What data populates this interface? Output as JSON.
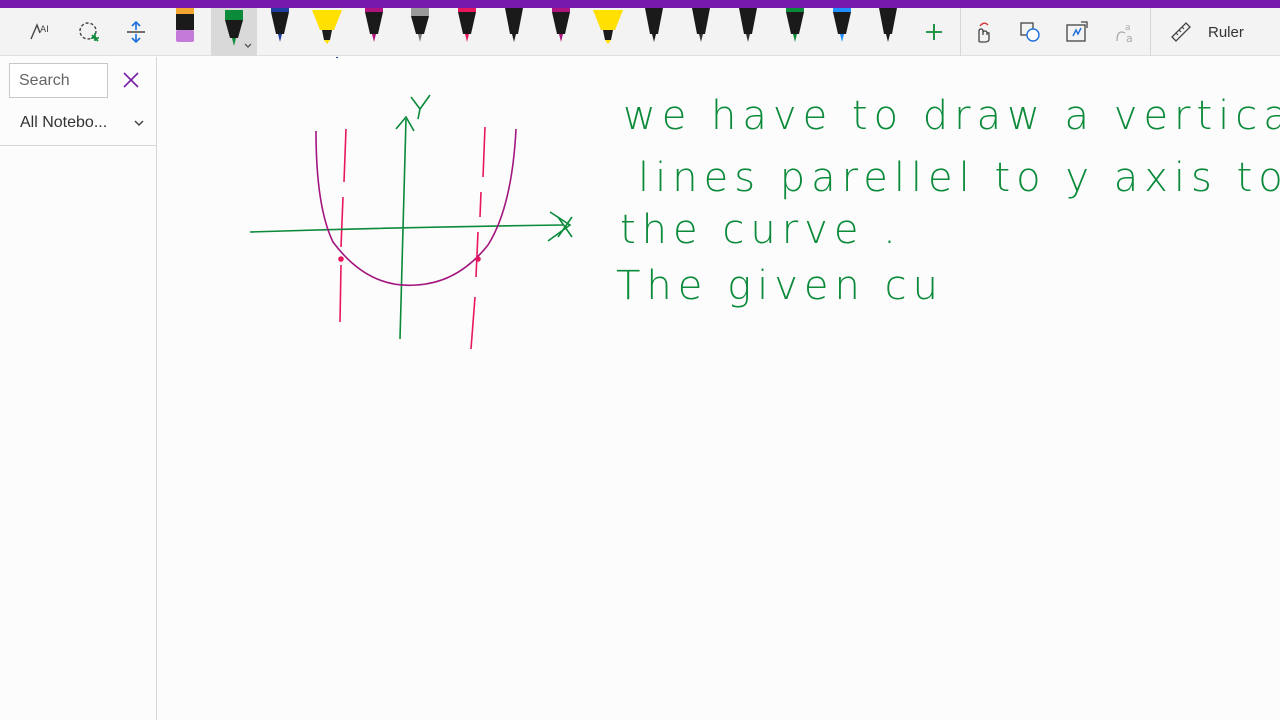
{
  "toolbar": {
    "ruler_label": "Ruler",
    "colors": {
      "accent": "#7719aa",
      "green": "#0b8a3a",
      "magenta": "#b0127f",
      "pink": "#e8175d",
      "yellow": "#ffe000",
      "blue": "#1e90ff",
      "black": "#1a1a1a"
    }
  },
  "sidebar": {
    "search_placeholder": "Search",
    "notebook_label": "All Notebo..."
  },
  "notes": {
    "line1": "we have to draw a vertical",
    "line2": "lines parellel to y axis to",
    "line3": "the curve .",
    "line4": "The given cu",
    "axis_y": "y",
    "axis_x": "x"
  }
}
